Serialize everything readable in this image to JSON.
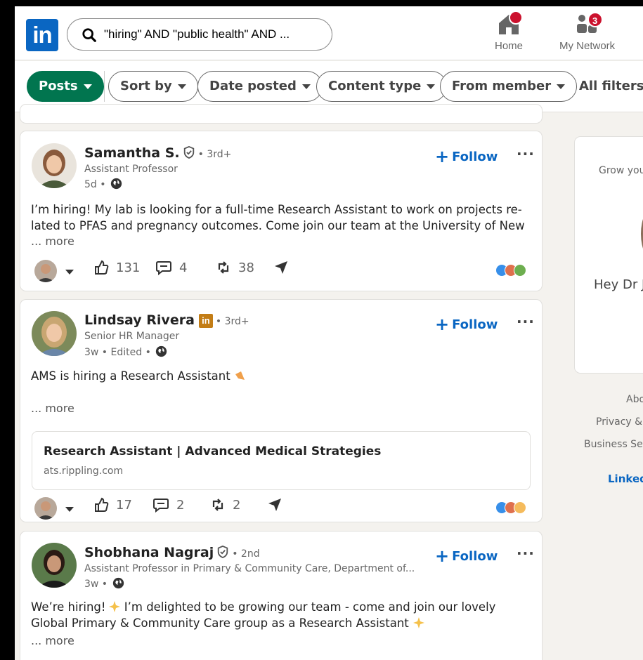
{
  "topnav": {
    "search_query": "\"hiring\" AND \"public health\" AND ...",
    "logo_text": "in",
    "home": {
      "label": "Home",
      "badge": ""
    },
    "network": {
      "label": "My Network",
      "badge": "3"
    }
  },
  "filters": {
    "posts": "Posts",
    "sort_by": "Sort by",
    "date_posted": "Date posted",
    "content_type": "Content type",
    "from_member": "From member",
    "all_filters": "All filters"
  },
  "posts": [
    {
      "name": "Samantha S.",
      "degree": "• 3rd+",
      "headline": "Assistant Professor",
      "meta": "5d •",
      "follow": "Follow",
      "text": "I’m hiring! My lab is looking for a full-time Research Assistant to work on projects re-lated to PFAS and pregnancy outcomes. Come join our team at the University of New",
      "more": "... more",
      "likes": "131",
      "comments": "4",
      "reposts": "38"
    },
    {
      "name": "Lindsay Rivera",
      "degree": "• 3rd+",
      "headline": "Senior HR Manager",
      "meta": "3w • Edited •",
      "follow": "Follow",
      "text": "AMS is hiring a Research Assistant",
      "more": "... more",
      "link_title": "Research Assistant | Advanced Medical Strategies",
      "link_domain": "ats.rippling.com",
      "likes": "17",
      "comments": "2",
      "reposts": "2"
    },
    {
      "name": "Shobhana Nagraj",
      "degree": "• 2nd",
      "headline": "Assistant Professor in Primary & Community Care, Department of...",
      "meta": "3w •",
      "follow": "Follow",
      "text_line1": "We’re hiring!",
      "text_line1b": " I’m delighted to be growing our team - come and join our lovely",
      "text_line2": "Global Primary & Community Care group as a Research Assistant",
      "more": "... more"
    }
  ],
  "rail": {
    "grow": "Grow you",
    "hey": "Hey Dr J",
    "footer_about": "Abo",
    "footer_privacy": "Privacy &",
    "footer_business": "Business Ser",
    "footer_brand": "Linked"
  },
  "colors": {
    "accent": "#0a66c2",
    "posts_active": "#01754f",
    "badge": "#cb112d"
  }
}
